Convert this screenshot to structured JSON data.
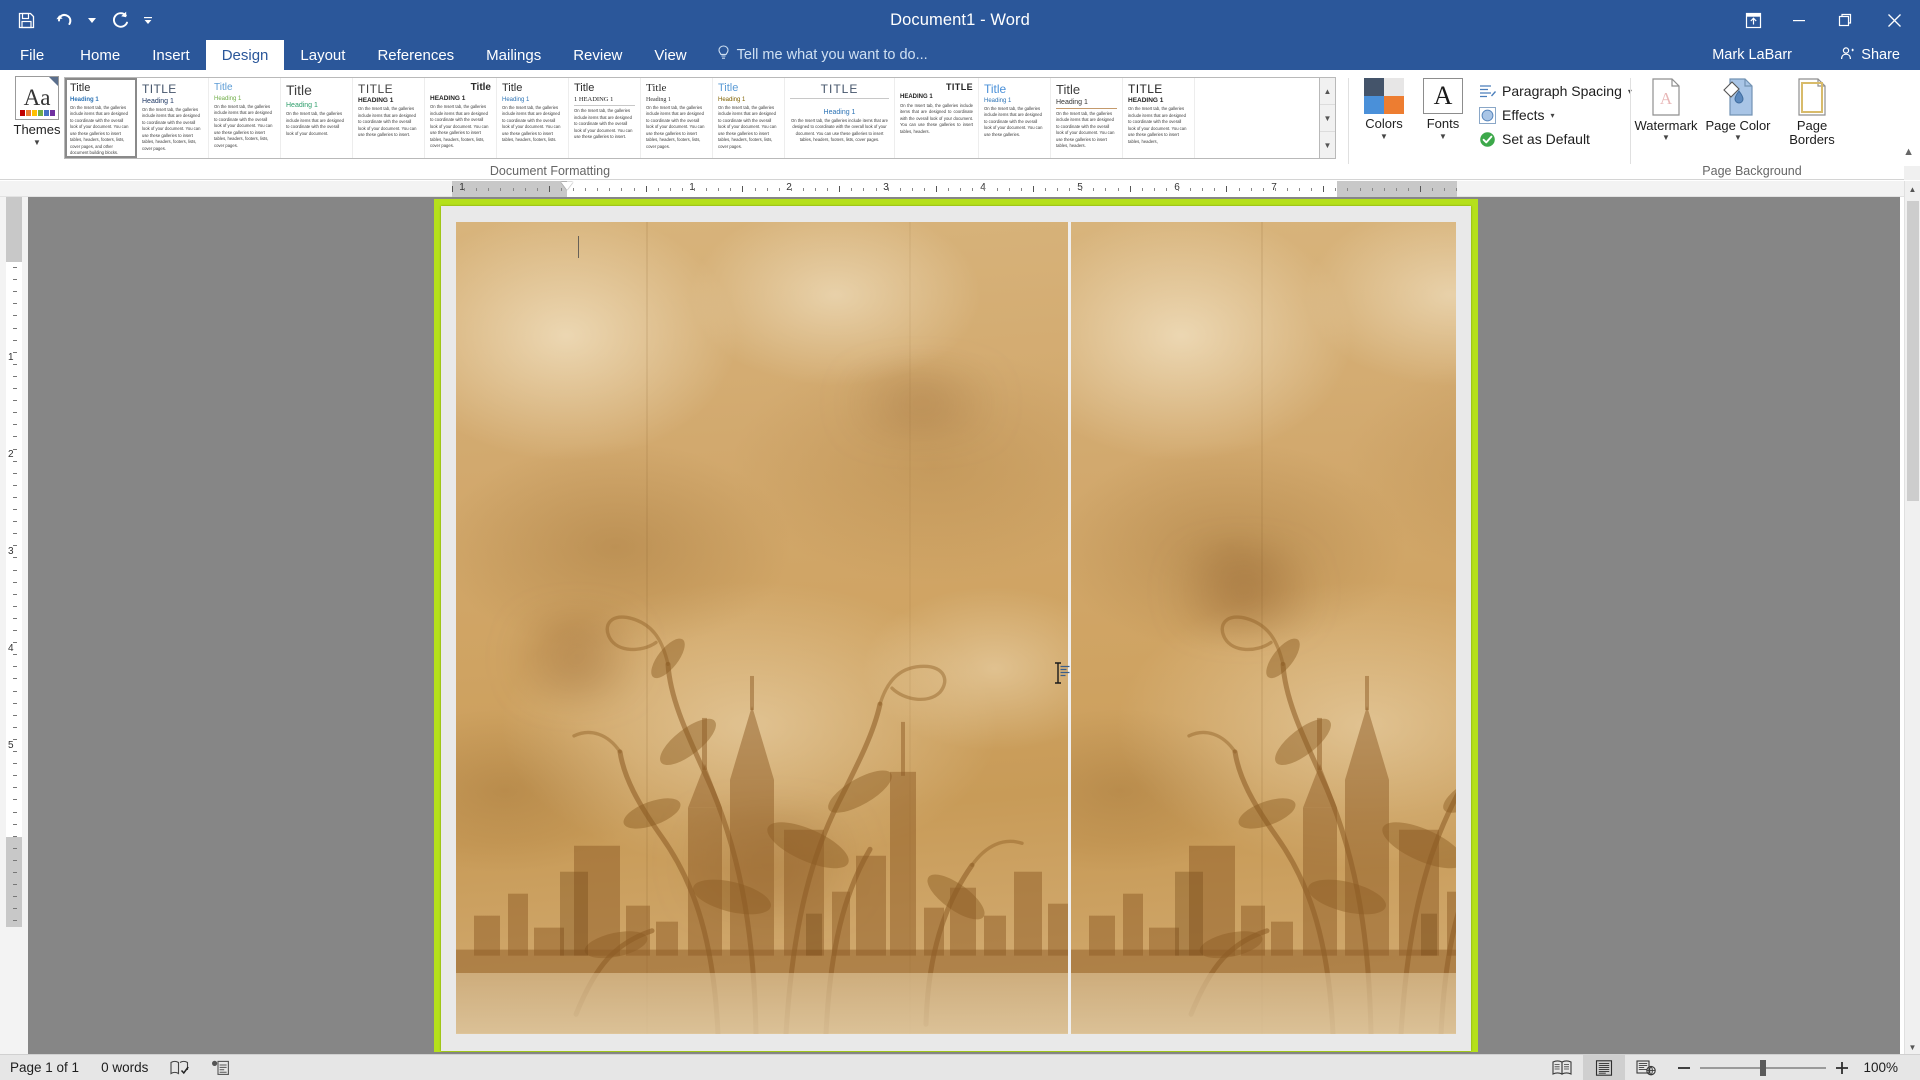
{
  "titlebar": {
    "document_title": "Document1 - Word",
    "qat": [
      {
        "name": "save",
        "label": "Save"
      },
      {
        "name": "undo",
        "label": "Undo"
      },
      {
        "name": "redo",
        "label": "Repeat"
      },
      {
        "name": "customize",
        "label": "Customize Quick Access Toolbar"
      }
    ],
    "ribbon_display_options": "Ribbon Display Options",
    "minimize": "Minimize",
    "restore": "Restore Down",
    "close": "Close"
  },
  "tabs": [
    {
      "label": "File",
      "active": false
    },
    {
      "label": "Home",
      "active": false
    },
    {
      "label": "Insert",
      "active": false
    },
    {
      "label": "Design",
      "active": true
    },
    {
      "label": "Layout",
      "active": false
    },
    {
      "label": "References",
      "active": false
    },
    {
      "label": "Mailings",
      "active": false
    },
    {
      "label": "Review",
      "active": false
    },
    {
      "label": "View",
      "active": false
    }
  ],
  "tellme": {
    "placeholder": "Tell me what you want to do...",
    "icon": "lightbulb-icon"
  },
  "account": {
    "user_name": "Mark LaBarr",
    "share_label": "Share"
  },
  "ribbon": {
    "groups": [
      {
        "name": "document-formatting",
        "label": "Document Formatting"
      },
      {
        "name": "page-background",
        "label": "Page Background"
      }
    ],
    "themes": {
      "label": "Themes",
      "icon_text": "Aa"
    },
    "gallery": [
      {
        "title": "Title",
        "heading": "Heading 1",
        "body": "On the Insert tab, the galleries include items that are designed to coordinate with the overall look of your document. You can use these galleries to insert tables, headers, footers, lists, cover pages, and other document building blocks.",
        "style": "office",
        "selected": true
      },
      {
        "title": "TITLE",
        "heading": "Heading 1",
        "body": "On the Insert tab, the galleries include items that are designed to coordinate with the overall look of your document. You can use these galleries to insert tables, headers, footers, lists, cover pages.",
        "style": "caps-serif",
        "selected": false
      },
      {
        "title": "Title",
        "heading": "Heading 1",
        "body": "On the Insert tab, the galleries include items that are designed to coordinate with the overall look of your document. You can use these galleries to insert tables, headers, footers, lists, cover pages.",
        "style": "green",
        "selected": false
      },
      {
        "title": "Title",
        "heading": "Heading 1",
        "body": "On the Insert tab, the galleries include items that are designed to coordinate with the overall look of your document.",
        "style": "large-serif",
        "selected": false
      },
      {
        "title": "TITLE",
        "heading": "HEADING 1",
        "body": "On the Insert tab, the galleries include items that are designed to coordinate with the overall look of your document. You can use these galleries to insert.",
        "style": "allcaps",
        "selected": false
      },
      {
        "title": "Title",
        "heading": "HEADING 1",
        "body": "On the Insert tab, the galleries include items that are designed to coordinate with the overall look of your document. You can use these galleries to insert tables, headers, footers, lists, cover pages.",
        "style": "bold-caps",
        "selected": false
      },
      {
        "title": "Title",
        "heading": "Heading 1",
        "body": "On the Insert tab, the galleries include items that are designed to coordinate with the overall look of your document. You can use these galleries to insert tables, headers, footers, lists.",
        "style": "plain",
        "selected": false
      },
      {
        "title": "Title",
        "heading": "1  HEADING 1",
        "body": "On the Insert tab, the galleries include items that are designed to coordinate with the overall look of your document. You can use these galleries to insert.",
        "style": "numbered",
        "selected": false
      },
      {
        "title": "Title",
        "heading": "Heading 1",
        "body": "On the Insert tab, the galleries include items that are designed to coordinate with the overall look of your document. You can use these galleries to insert tables, headers, footers, lists, cover pages.",
        "style": "serif-light",
        "selected": false
      },
      {
        "title": "Title",
        "heading": "Heading 1",
        "body": "On the Insert tab, the galleries include items that are designed to coordinate with the overall look of your document. You can use these galleries to insert tables, headers, footers, lists, cover pages.",
        "style": "blue-title",
        "selected": false
      },
      {
        "title": "TITLE",
        "heading": "Heading 1",
        "body": "On the Insert tab, the galleries include items that are designed to coordinate with the overall look of your document. You can use these galleries to insert tables, headers, footers, lists, cover pages.",
        "style": "centered-caps",
        "selected": false
      },
      {
        "title": "TITLE",
        "heading": "HEADING 1",
        "body": "On the Insert tab, the galleries include items that are designed to coordinate with the overall look of your document. You can use these galleries to insert tables, headers.",
        "style": "right-caps",
        "selected": false
      },
      {
        "title": "Title",
        "heading": "Heading 1",
        "body": "On the Insert tab, the galleries include items that are designed to coordinate with the overall look of your document. You can use these galleries.",
        "style": "blue-serif",
        "selected": false
      },
      {
        "title": "Title",
        "heading": "Heading 1",
        "body": "On the Insert tab, the galleries include items that are designed to coordinate with the overall look of your document. You can use these galleries to insert tables, headers.",
        "style": "underline-head",
        "selected": false
      },
      {
        "title": "TITLE",
        "heading": "HEADING 1",
        "body": "On the Insert tab, the galleries include items that are designed to coordinate with the overall look of your document. You can use these galleries to insert tables, headers,",
        "style": "serif-caps",
        "selected": false
      }
    ],
    "gallery_scroll": {
      "up": "Scroll Up",
      "down": "Scroll Down",
      "more": "More"
    },
    "colors": {
      "label": "Colors",
      "swatches": [
        "#44546a",
        "#e7e6e6",
        "#4a90d9",
        "#ed7d31"
      ]
    },
    "fonts": {
      "label": "Fonts",
      "icon_text": "A"
    },
    "paragraph_spacing": {
      "label": "Paragraph Spacing",
      "icon": "paragraph-spacing-icon"
    },
    "effects": {
      "label": "Effects",
      "icon": "effects-circle-icon"
    },
    "set_as_default": {
      "label": "Set as Default",
      "icon": "check-circle-icon"
    },
    "watermark": {
      "label": "Watermark",
      "icon": "watermark-icon"
    },
    "page_color": {
      "label": "Page Color",
      "icon": "page-color-icon"
    },
    "page_borders": {
      "label": "Page Borders",
      "icon": "page-borders-icon"
    },
    "collapse": "Collapse the Ribbon"
  },
  "ruler": {
    "horizontal_numbers": [
      "1",
      "1",
      "2",
      "3",
      "4",
      "5",
      "6",
      "7"
    ],
    "vertical_numbers": [
      "1",
      "2",
      "3",
      "4",
      "5"
    ],
    "unit": "inches"
  },
  "document": {
    "page_background": "sepia-parchment-cityscape-watermark",
    "highlight_color": "#b5e01b",
    "content_text": "",
    "paste_options_visible": true
  },
  "statusbar": {
    "page_indicator": "Page 1 of 1",
    "word_count": "0 words",
    "proofing_icon": "proofing-errors-icon",
    "macro_icon": "macro-record-icon",
    "views": [
      {
        "name": "read-mode",
        "label": "Read Mode",
        "active": false
      },
      {
        "name": "print-layout",
        "label": "Print Layout",
        "active": true
      },
      {
        "name": "web-layout",
        "label": "Web Layout",
        "active": false
      }
    ],
    "zoom_out": "Zoom Out",
    "zoom_in": "Zoom In",
    "zoom_level": "100%"
  }
}
